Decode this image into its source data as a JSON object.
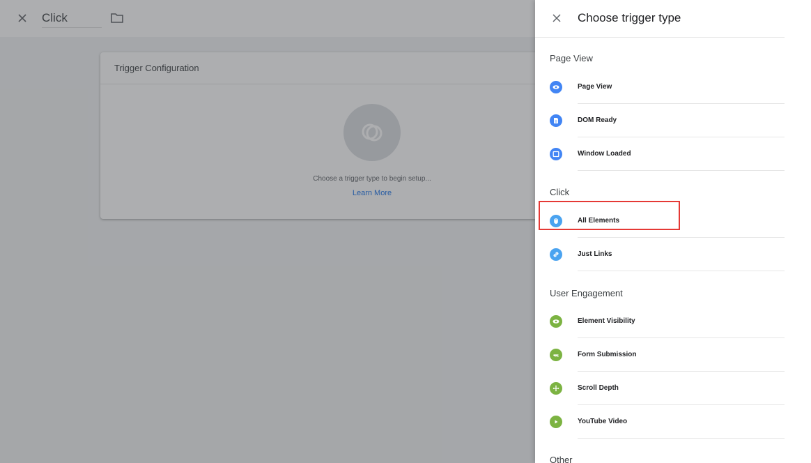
{
  "editor": {
    "trigger_name": "Click",
    "card": {
      "title": "Trigger Configuration",
      "hint": "Choose a trigger type to begin setup...",
      "learn_more": "Learn More"
    }
  },
  "panel": {
    "title": "Choose trigger type",
    "sections": [
      {
        "label": "Page View",
        "items": [
          {
            "label": "Page View",
            "icon": "eye-icon",
            "color": "#4285f4"
          },
          {
            "label": "DOM Ready",
            "icon": "document-icon",
            "color": "#4285f4"
          },
          {
            "label": "Window Loaded",
            "icon": "window-icon",
            "color": "#4285f4"
          }
        ]
      },
      {
        "label": "Click",
        "items": [
          {
            "label": "All Elements",
            "icon": "cursor-icon",
            "color": "#4aa3f0"
          },
          {
            "label": "Just Links",
            "icon": "link-icon",
            "color": "#4aa3f0"
          }
        ]
      },
      {
        "label": "User Engagement",
        "items": [
          {
            "label": "Element Visibility",
            "icon": "eye-icon",
            "color": "#7cb342"
          },
          {
            "label": "Form Submission",
            "icon": "form-icon",
            "color": "#7cb342"
          },
          {
            "label": "Scroll Depth",
            "icon": "scroll-icon",
            "color": "#7cb342"
          },
          {
            "label": "YouTube Video",
            "icon": "play-icon",
            "color": "#7cb342"
          }
        ]
      },
      {
        "label": "Other",
        "items": []
      }
    ]
  },
  "highlight_color": "#e53935"
}
